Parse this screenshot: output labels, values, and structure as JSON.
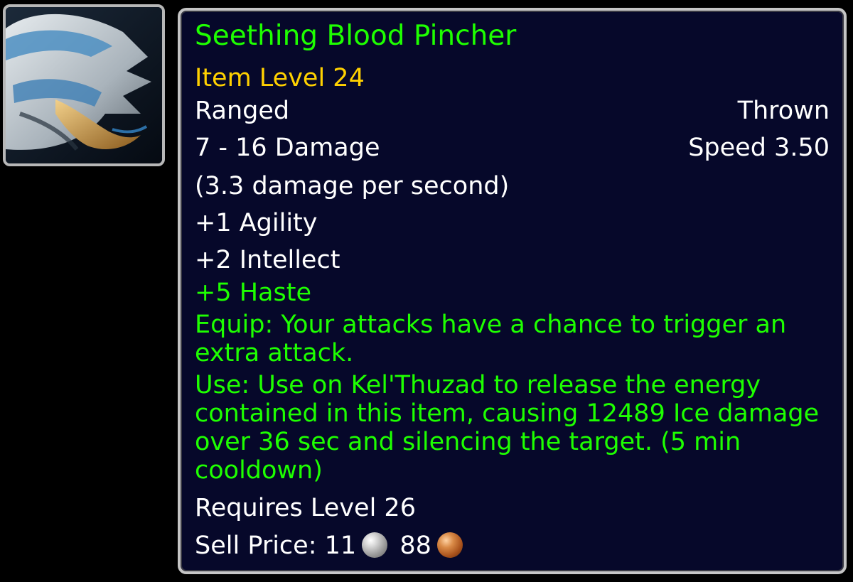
{
  "item": {
    "icon_name": "blood-pincher-claw-icon",
    "name": "Seething Blood Pincher",
    "item_level": "Item Level 24",
    "slot": "Ranged",
    "type": "Thrown",
    "damage": "7 - 16 Damage",
    "speed": "Speed 3.50",
    "dps": "(3.3 damage per second)",
    "stats": [
      "+1 Agility",
      "+2 Intellect"
    ],
    "bonus_stat": "+5 Haste",
    "equip_effect": "Equip: Your attacks have a chance to trigger an extra attack.",
    "use_effect": "Use: Use on Kel'Thuzad to release the energy contained in this item, causing 12489 Ice damage over 36 sec and silencing the target. (5 min cooldown)",
    "requires": "Requires Level 26",
    "sell_label": "Sell Price:",
    "sell_silver": "11",
    "sell_copper": "88"
  },
  "colors": {
    "uncommon_green": "#1eff00",
    "item_level_gold": "#ffd100",
    "tooltip_bg": "#06082a",
    "border": "#c5c5c5",
    "text_white": "#ffffff"
  }
}
